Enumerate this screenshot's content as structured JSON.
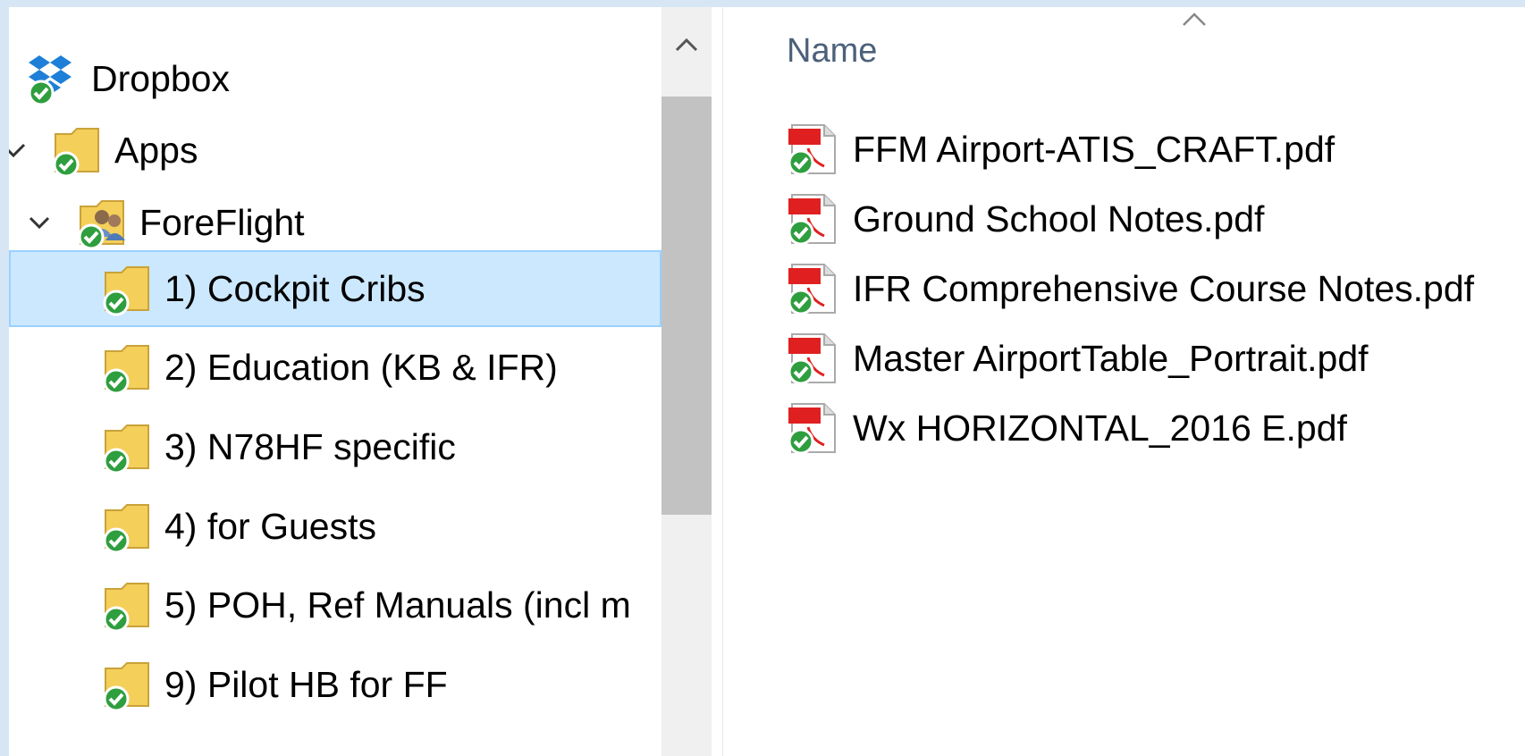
{
  "navigation_pane": {
    "items": [
      {
        "label": "Dropbox",
        "icon": "dropbox-icon",
        "expand_state": "none",
        "selected": false
      },
      {
        "label": "Apps",
        "icon": "folder-icon",
        "expand_state": "checked",
        "selected": false
      },
      {
        "label": "ForeFlight",
        "icon": "shared-folder-icon",
        "expand_state": "expanded",
        "selected": false
      },
      {
        "label": "1) Cockpit Cribs",
        "icon": "folder-icon",
        "expand_state": "none",
        "selected": true
      },
      {
        "label": "2) Education (KB & IFR)",
        "icon": "folder-icon",
        "expand_state": "none",
        "selected": false
      },
      {
        "label": "3) N78HF specific",
        "icon": "folder-icon",
        "expand_state": "none",
        "selected": false
      },
      {
        "label": "4) for Guests",
        "icon": "folder-icon",
        "expand_state": "none",
        "selected": false
      },
      {
        "label": "5) POH, Ref Manuals (incl m",
        "icon": "folder-icon",
        "expand_state": "none",
        "selected": false
      },
      {
        "label": "9) Pilot HB for FF",
        "icon": "folder-icon",
        "expand_state": "none",
        "selected": false
      }
    ]
  },
  "file_list": {
    "column_header": "Name",
    "sort_indicator": "sort-ascending-icon",
    "files": [
      {
        "name": "FFM Airport-ATIS_CRAFT.pdf",
        "icon": "pdf-file-icon"
      },
      {
        "name": "Ground School Notes.pdf",
        "icon": "pdf-file-icon"
      },
      {
        "name": "IFR Comprehensive Course Notes.pdf",
        "icon": "pdf-file-icon"
      },
      {
        "name": "Master AirportTable_Portrait.pdf",
        "icon": "pdf-file-icon"
      },
      {
        "name": "Wx  HORIZONTAL_2016 E.pdf",
        "icon": "pdf-file-icon"
      }
    ]
  },
  "colors": {
    "selection_background": "#cce8ff",
    "selection_border": "#99d1ff",
    "sync_badge": "#2e9e3e",
    "folder_yellow": "#f4cf5a",
    "pdf_red": "#e02020",
    "dropbox_blue": "#1d7fd8",
    "window_frame": "#d6e6f5"
  }
}
